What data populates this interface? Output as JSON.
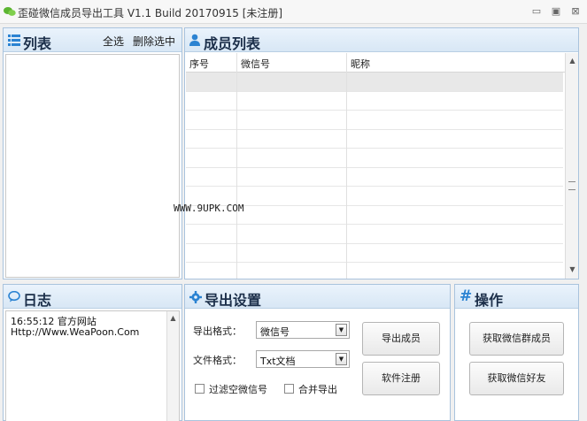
{
  "window": {
    "title": "歪碰微信成员导出工具 V1.1 Build 20170915    [未注册]",
    "controls": [
      "▭",
      "▣",
      "⊠"
    ]
  },
  "list_panel": {
    "icon": "list-icon",
    "title": "列表",
    "select_all": "全选",
    "delete_selected": "删除选中"
  },
  "members_panel": {
    "icon": "person-icon",
    "title": "成员列表",
    "columns": [
      "序号",
      "微信号",
      "昵称"
    ],
    "row_count": 10
  },
  "log_panel": {
    "icon": "speech-bubble-icon",
    "title": "日志",
    "lines": [
      "16:55:12   官方网站",
      "Http://Www.WeaPoon.Com"
    ]
  },
  "export_panel": {
    "icon": "gear-icon",
    "title": "导出设置",
    "format_label": "导出格式：",
    "format_value": "微信号",
    "file_format_label": "文件格式：",
    "file_format_value": "Txt文档",
    "filter_empty_label": "过滤空微信号",
    "filter_empty_checked": false,
    "merge_export_label": "合并导出",
    "merge_export_checked": false,
    "export_button": "导出成员",
    "register_button": "软件注册"
  },
  "ops_panel": {
    "icon": "hash-icon",
    "title": "操作",
    "get_group_members": "获取微信群成员",
    "get_friends": "获取微信好友"
  },
  "watermark": "WWW.9UPK.COM",
  "colors": {
    "accent": "#2b83d2",
    "panel_border": "#a9c3dd",
    "header_gradient_top": "#eaf3fc",
    "header_gradient_bottom": "#d8e7f5"
  }
}
